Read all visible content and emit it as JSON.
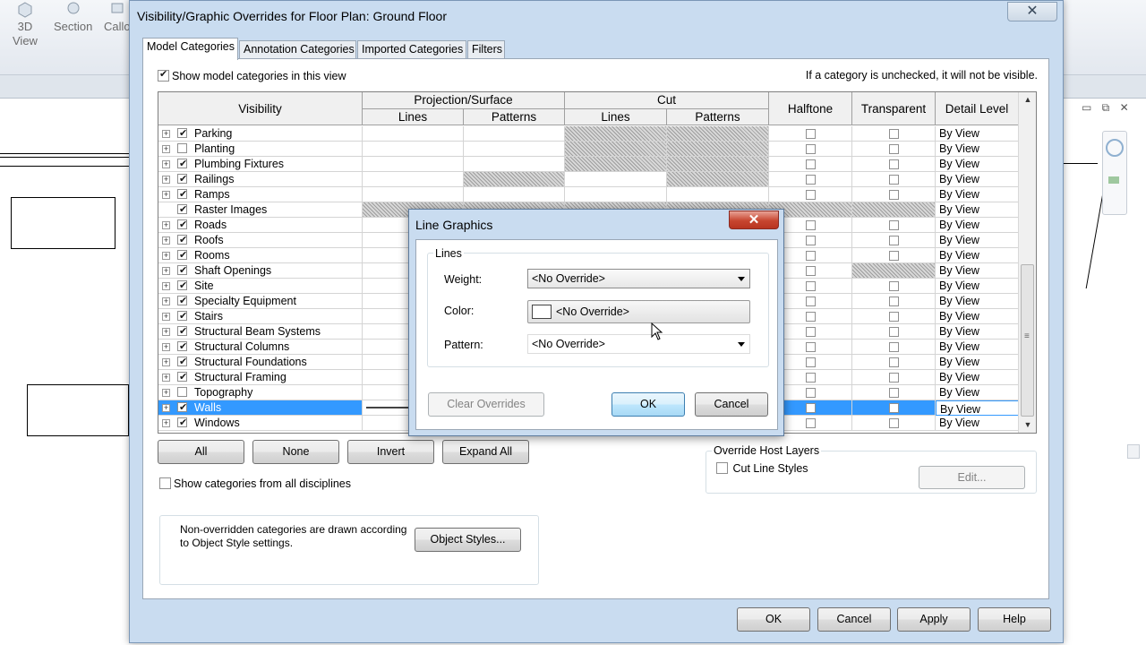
{
  "ribbon": {
    "btn_3d": "3D",
    "btn_3d_sub": "View",
    "btn_section": "Section",
    "btn_callout": "Callo"
  },
  "dialog": {
    "title": "Visibility/Graphic Overrides for Floor Plan: Ground Floor",
    "close_glyph": "✕",
    "tabs": [
      "Model Categories",
      "Annotation Categories",
      "Imported Categories",
      "Filters"
    ],
    "active_tab": "Model Categories",
    "show_model_label": "Show model categories in this view",
    "show_model_checked": true,
    "hint": "If a category is unchecked, it will not be visible.",
    "headers": {
      "visibility": "Visibility",
      "projection": "Projection/Surface",
      "cut": "Cut",
      "lines": "Lines",
      "patterns": "Patterns",
      "halftone": "Halftone",
      "transparent": "Transparent",
      "detail_level": "Detail Level"
    },
    "rows": [
      {
        "name": "Parking",
        "checked": true,
        "expand": true,
        "hatch": [
          false,
          false,
          true,
          true,
          false,
          false
        ],
        "detail": "By View"
      },
      {
        "name": "Planting",
        "checked": false,
        "expand": true,
        "hatch": [
          false,
          false,
          true,
          true,
          false,
          false
        ],
        "detail": "By View"
      },
      {
        "name": "Plumbing Fixtures",
        "checked": true,
        "expand": true,
        "hatch": [
          false,
          false,
          true,
          true,
          false,
          false
        ],
        "detail": "By View"
      },
      {
        "name": "Railings",
        "checked": true,
        "expand": true,
        "hatch": [
          false,
          true,
          false,
          true,
          false,
          false
        ],
        "detail": "By View"
      },
      {
        "name": "Ramps",
        "checked": true,
        "expand": true,
        "hatch": [
          false,
          false,
          false,
          false,
          false,
          false
        ],
        "detail": "By View"
      },
      {
        "name": "Raster Images",
        "checked": true,
        "expand": false,
        "hatch": [
          true,
          true,
          true,
          true,
          true,
          true
        ],
        "detail": "By View"
      },
      {
        "name": "Roads",
        "checked": true,
        "expand": true,
        "hatch": [
          false,
          false,
          false,
          false,
          false,
          false
        ],
        "detail": "By View"
      },
      {
        "name": "Roofs",
        "checked": true,
        "expand": true,
        "hatch": [
          false,
          false,
          false,
          false,
          false,
          false
        ],
        "detail": "By View"
      },
      {
        "name": "Rooms",
        "checked": true,
        "expand": true,
        "hatch": [
          false,
          true,
          false,
          false,
          false,
          false
        ],
        "detail": "By View"
      },
      {
        "name": "Shaft Openings",
        "checked": true,
        "expand": true,
        "hatch": [
          false,
          false,
          false,
          false,
          false,
          true
        ],
        "detail": "By View"
      },
      {
        "name": "Site",
        "checked": true,
        "expand": true,
        "hatch": [
          false,
          false,
          false,
          false,
          false,
          false
        ],
        "detail": "By View"
      },
      {
        "name": "Specialty Equipment",
        "checked": true,
        "expand": true,
        "hatch": [
          false,
          false,
          false,
          false,
          false,
          false
        ],
        "detail": "By View"
      },
      {
        "name": "Stairs",
        "checked": true,
        "expand": true,
        "hatch": [
          false,
          false,
          false,
          false,
          false,
          false
        ],
        "detail": "By View"
      },
      {
        "name": "Structural Beam Systems",
        "checked": true,
        "expand": true,
        "hatch": [
          false,
          false,
          false,
          false,
          false,
          false
        ],
        "detail": "By View"
      },
      {
        "name": "Structural Columns",
        "checked": true,
        "expand": true,
        "hatch": [
          false,
          false,
          false,
          false,
          false,
          false
        ],
        "detail": "By View"
      },
      {
        "name": "Structural Foundations",
        "checked": true,
        "expand": true,
        "hatch": [
          false,
          false,
          false,
          false,
          false,
          false
        ],
        "detail": "By View"
      },
      {
        "name": "Structural Framing",
        "checked": true,
        "expand": true,
        "hatch": [
          false,
          false,
          false,
          false,
          false,
          false
        ],
        "detail": "By View"
      },
      {
        "name": "Topography",
        "checked": false,
        "expand": true,
        "hatch": [
          false,
          false,
          false,
          false,
          false,
          false
        ],
        "detail": "By View"
      },
      {
        "name": "Walls",
        "checked": true,
        "expand": true,
        "hatch": [
          false,
          false,
          false,
          false,
          false,
          false
        ],
        "detail": "By View",
        "selected": true
      },
      {
        "name": "Windows",
        "checked": true,
        "expand": true,
        "hatch": [
          false,
          false,
          false,
          false,
          false,
          false
        ],
        "detail": "By View"
      }
    ],
    "buttons": {
      "all": "All",
      "none": "None",
      "invert": "Invert",
      "expand_all": "Expand All",
      "object_styles": "Object Styles...",
      "edit": "Edit...",
      "ok": "OK",
      "cancel": "Cancel",
      "apply": "Apply",
      "help": "Help"
    },
    "show_all_disciplines_label": "Show categories from all disciplines",
    "show_all_disciplines_checked": false,
    "note": "Non-overridden categories are drawn according to Object Style settings.",
    "override_host_layers": {
      "title": "Override Host Layers",
      "cut_line_styles": "Cut Line Styles",
      "cut_line_styles_checked": false
    }
  },
  "line_graphics": {
    "title": "Line Graphics",
    "close_glyph": "✕",
    "group": "Lines",
    "weight_label": "Weight:",
    "weight_value": "<No Override>",
    "color_label": "Color:",
    "color_value": "<No Override>",
    "pattern_label": "Pattern:",
    "pattern_value": "<No Override>",
    "clear_overrides": "Clear Overrides",
    "ok": "OK",
    "cancel": "Cancel"
  },
  "colors": {
    "selection": "#3399ff",
    "dialog_frame": "#c9dcf0",
    "close_red": "#c7452f"
  }
}
